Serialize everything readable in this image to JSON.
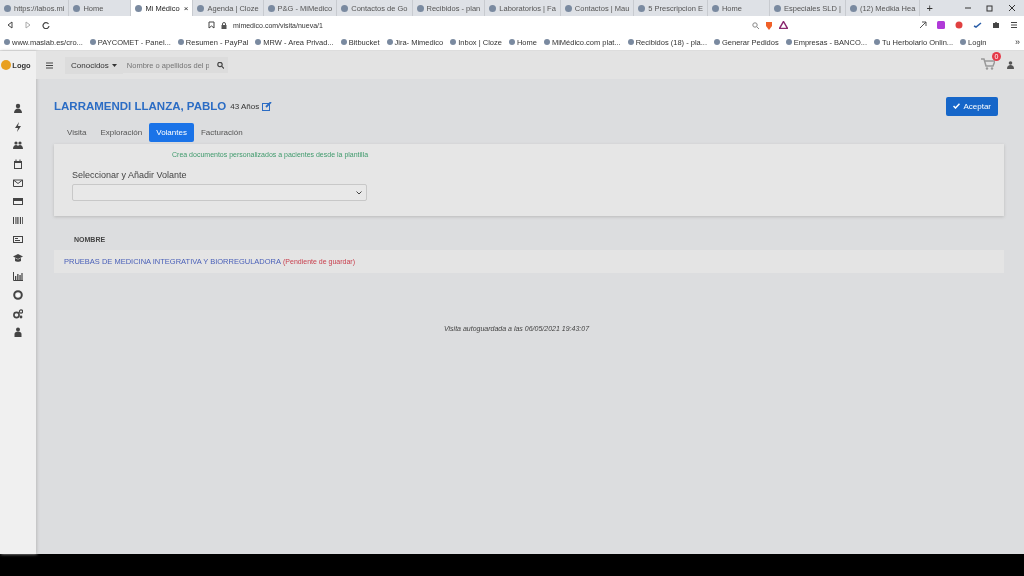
{
  "browser": {
    "tabs": [
      {
        "label": "https://labos.mi",
        "selected": false
      },
      {
        "label": "Home",
        "selected": false
      },
      {
        "label": "Mi Médico",
        "selected": true
      },
      {
        "label": "Agenda | Cloze",
        "selected": false
      },
      {
        "label": "P&G - MiMedico",
        "selected": false
      },
      {
        "label": "Contactos de Go",
        "selected": false
      },
      {
        "label": "Recibidos - plan",
        "selected": false
      },
      {
        "label": "Laboratorios | Fa",
        "selected": false
      },
      {
        "label": "Contactos | Mau",
        "selected": false
      },
      {
        "label": "5 Prescripcion E",
        "selected": false
      },
      {
        "label": "Home",
        "selected": false
      },
      {
        "label": "Especiales SLD |",
        "selected": false
      },
      {
        "label": "(12) Medkia Hea",
        "selected": false
      }
    ],
    "new_tab": "+",
    "close_tab": "×",
    "url": "mimedico.com/visita/nueva/1",
    "bookmarks": [
      "www.maslab.es/cro...",
      "PAYCOMET - Panel...",
      "Resumen - PayPal",
      "MRW - Area Privad...",
      "Bitbucket",
      "Jira- Mimedico",
      "Inbox | Cloze",
      "Home",
      "MiMédico.com plat...",
      "Recibidos (18) - pla...",
      "Generar Pedidos",
      "Empresas - BANCO...",
      "Tu Herbolario Onlin...",
      "Login"
    ],
    "more": "»"
  },
  "app": {
    "logo": "Logo",
    "filter": "Conocidos",
    "search_placeholder": "Nombre o apellidos del p",
    "cart_count": "0",
    "patient": {
      "name": "LARRAMENDI LLANZA, PABLO",
      "age": "43 Años"
    },
    "accept_button": "Aceptar",
    "tabs": [
      {
        "label": "Visita",
        "selected": false
      },
      {
        "label": "Exploración",
        "selected": false
      },
      {
        "label": "Volantes",
        "selected": true
      },
      {
        "label": "Facturación",
        "selected": false
      }
    ],
    "card": {
      "hint": "Crea documentos personalizados a pacientes desde la plantilla",
      "label": "Seleccionar y Añadir Volante"
    },
    "table": {
      "columns": [
        "NOMBRE"
      ],
      "rows": [
        {
          "name": "PRUEBAS DE MEDICINA INTEGRATIVA Y BIORREGULADORA",
          "status": "(Pendiente de guardar)"
        }
      ]
    },
    "autosave": "Visita autoguardada a las 06/05/2021 19:43:07"
  }
}
